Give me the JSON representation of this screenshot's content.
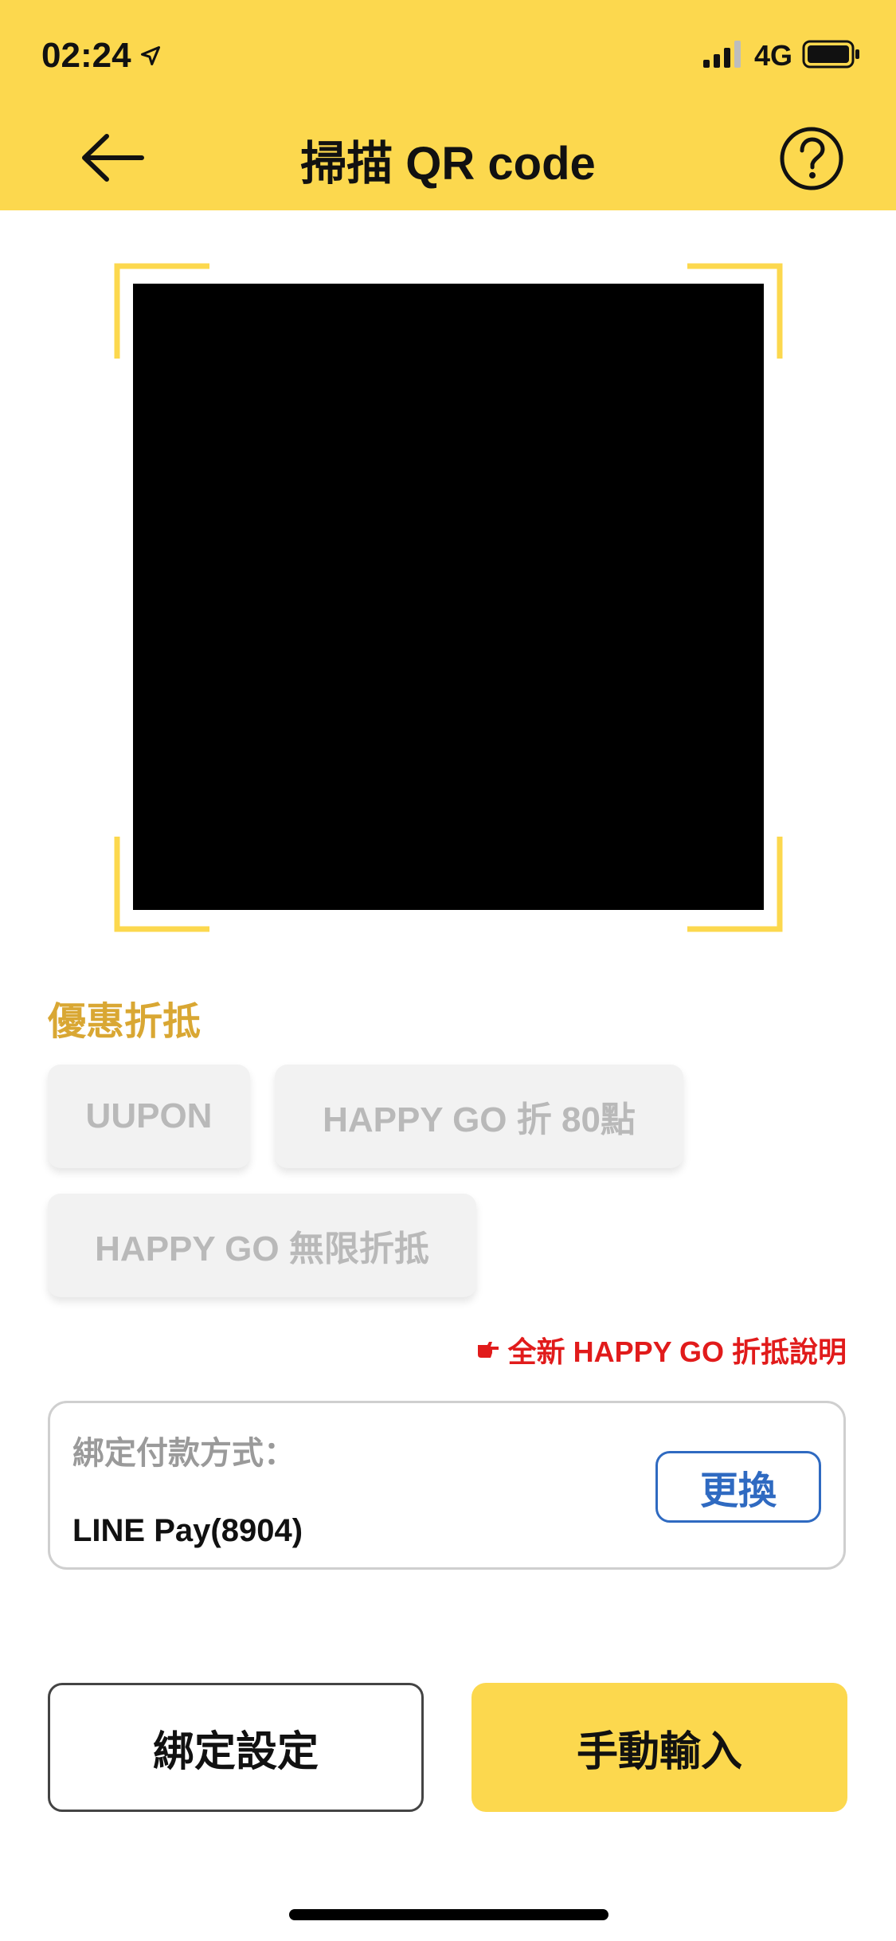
{
  "status_bar": {
    "time": "02:24",
    "network": "4G",
    "icons": [
      "location-arrow-icon",
      "signal-icon",
      "battery-icon"
    ]
  },
  "header": {
    "title": "掃描 QR code",
    "back_icon": "arrow-left-icon",
    "help_icon": "question-circle-icon"
  },
  "discounts": {
    "title": "優惠折抵",
    "options": [
      "UUPON",
      "HAPPY GO 折 80點",
      "HAPPY GO 無限折抵"
    ],
    "explain_link": "全新 HAPPY GO 折抵說明",
    "explain_icon": "pointing-hand-icon"
  },
  "payment": {
    "label": "綁定付款方式：",
    "value": "LINE Pay(8904)",
    "change_label": "更換"
  },
  "actions": {
    "binding_settings": "綁定設定",
    "manual_input": "手動輸入"
  },
  "colors": {
    "brand_yellow": "#fcd84e",
    "section_title": "#d9a733",
    "link_red": "#e11b1b",
    "change_blue": "#2f6ac1",
    "chip_bg": "#f2f2f2",
    "chip_text": "#b9b9b9"
  }
}
